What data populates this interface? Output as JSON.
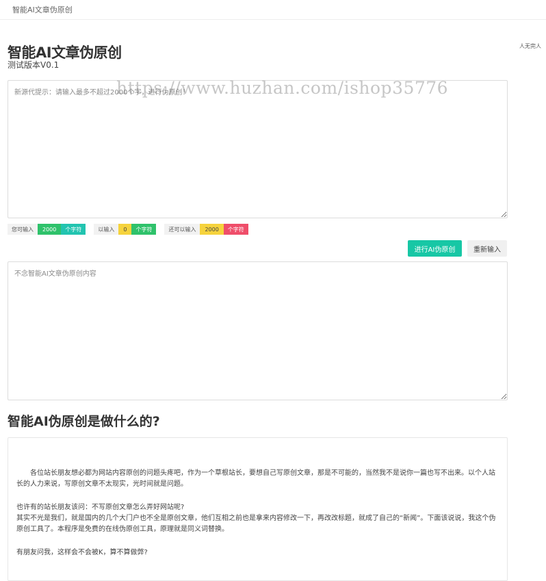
{
  "header": {
    "brand": "智能AI文章伪原创",
    "side_note": "人无完人"
  },
  "page": {
    "title": "智能AI文章伪原创",
    "subtitle": "测试版本V0.1",
    "watermark": "https://www.huzhan.com/ishop35776"
  },
  "input": {
    "placeholder": "新源代提示：请输入最多不超过2000个字，进行伪原创！",
    "value": ""
  },
  "counters": {
    "can_input_label": "您可输入",
    "can_input_value": "2000",
    "can_input_unit": "个字符",
    "entered_label": "以输入",
    "entered_value": "0",
    "entered_unit": "个字符",
    "remaining_label": "还可以输入",
    "remaining_value": "2000",
    "remaining_unit": "个字符"
  },
  "actions": {
    "rewrite_label": "进行AI伪原创",
    "reset_label": "重新输入"
  },
  "output": {
    "placeholder": "不念智能AI文章伪原创内容",
    "value": ""
  },
  "about": {
    "title": "智能AI伪原创是做什么的?",
    "p1": "各位站长朋友想必都为网站内容原创的问题头疼吧，作为一个草根站长，要想自己写原创文章，那是不可能的，当然我不是说你一篇也写不出来。以个人站长的人力来说，写原创文章不太现实，光时间就是问题。",
    "p2_line1": "也许有的站长朋友该问：不写原创文章怎么弄好网站呢?",
    "p2_line2": "其实不光是我们，就是国内的几个大门户也不全是原创文章，他们互相之前也是拿来内容修改一下，再改改标题，就成了自己的“新闻”。下面该说说，我这个伪原创工具了。本程序是免费的在线伪原创工具，原理就是同义词替换。",
    "p3": "有朋友问我，这样会不会被K，算不算做弊?"
  },
  "colors": {
    "accent": "#17c7a5",
    "badge_green": "#2fc26b",
    "badge_teal": "#22c4b0",
    "badge_yellow": "#f6d33d",
    "badge_red": "#ef4e6a"
  }
}
